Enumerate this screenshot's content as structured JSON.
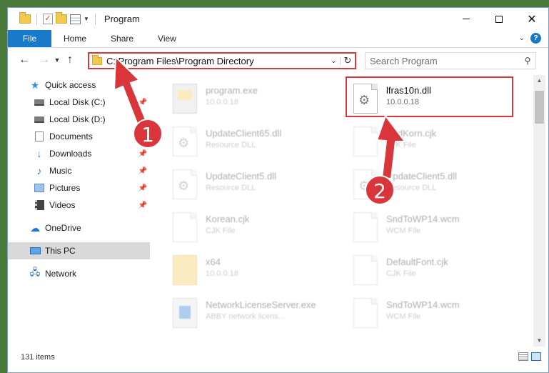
{
  "window": {
    "title": "Program"
  },
  "ribbon": {
    "tabs": [
      "File",
      "Home",
      "Share",
      "View"
    ]
  },
  "address": {
    "path": "C:\\Program Files\\Program Directory",
    "search_placeholder": "Search Program"
  },
  "nav": {
    "items": [
      {
        "label": "Quick access",
        "icon": "star-icon",
        "pinned": false
      },
      {
        "label": "Local Disk (C:)",
        "icon": "disk-icon",
        "pinned": true
      },
      {
        "label": "Local Disk (D:)",
        "icon": "disk-icon",
        "pinned": false
      },
      {
        "label": "Documents",
        "icon": "documents-icon",
        "pinned": true
      },
      {
        "label": "Downloads",
        "icon": "downloads-icon",
        "pinned": true
      },
      {
        "label": "Music",
        "icon": "music-icon",
        "pinned": true
      },
      {
        "label": "Pictures",
        "icon": "pictures-icon",
        "pinned": true
      },
      {
        "label": "Videos",
        "icon": "videos-icon",
        "pinned": true
      },
      {
        "label": "OneDrive",
        "icon": "onedrive-icon",
        "pinned": false
      },
      {
        "label": "This PC",
        "icon": "this-pc-icon",
        "pinned": false,
        "selected": true
      },
      {
        "label": "Network",
        "icon": "network-icon",
        "pinned": false
      }
    ]
  },
  "files": [
    {
      "name": "program.exe",
      "sub": "10.0.0.18",
      "type": "exe",
      "faded": true
    },
    {
      "name": "lfras10n.dll",
      "sub": "10.0.0.18",
      "type": "dll",
      "faded": false
    },
    {
      "name": "UpdateClient65.dll",
      "sub": "Resource DLL",
      "type": "dll",
      "faded": true
    },
    {
      "name": "SndKorn.cjk",
      "sub": "CJK File",
      "type": "doc",
      "faded": true
    },
    {
      "name": "UpdateClient5.dll",
      "sub": "Resource DLL",
      "type": "dll",
      "faded": true
    },
    {
      "name": "UpdateClient5.dll",
      "sub": "Resource DLL",
      "type": "dll",
      "faded": true
    },
    {
      "name": "Korean.cjk",
      "sub": "CJK File",
      "type": "doc",
      "faded": true
    },
    {
      "name": "SndToWP14.wcm",
      "sub": "WCM File",
      "type": "doc",
      "faded": true
    },
    {
      "name": "x64",
      "sub": "10.0.0.18",
      "type": "folder",
      "faded": true
    },
    {
      "name": "DefaultFont.cjk",
      "sub": "CJK File",
      "type": "doc",
      "faded": true
    },
    {
      "name": "NetworkLicenseServer.exe",
      "sub": "ABBY network licens...",
      "type": "app",
      "faded": true
    },
    {
      "name": "SndToWP14.wcm",
      "sub": "WCM File",
      "type": "doc",
      "faded": true
    }
  ],
  "status": {
    "item_count": "131 items"
  },
  "annotations": {
    "step1": "1",
    "step2": "2",
    "color": "#d9353b"
  }
}
